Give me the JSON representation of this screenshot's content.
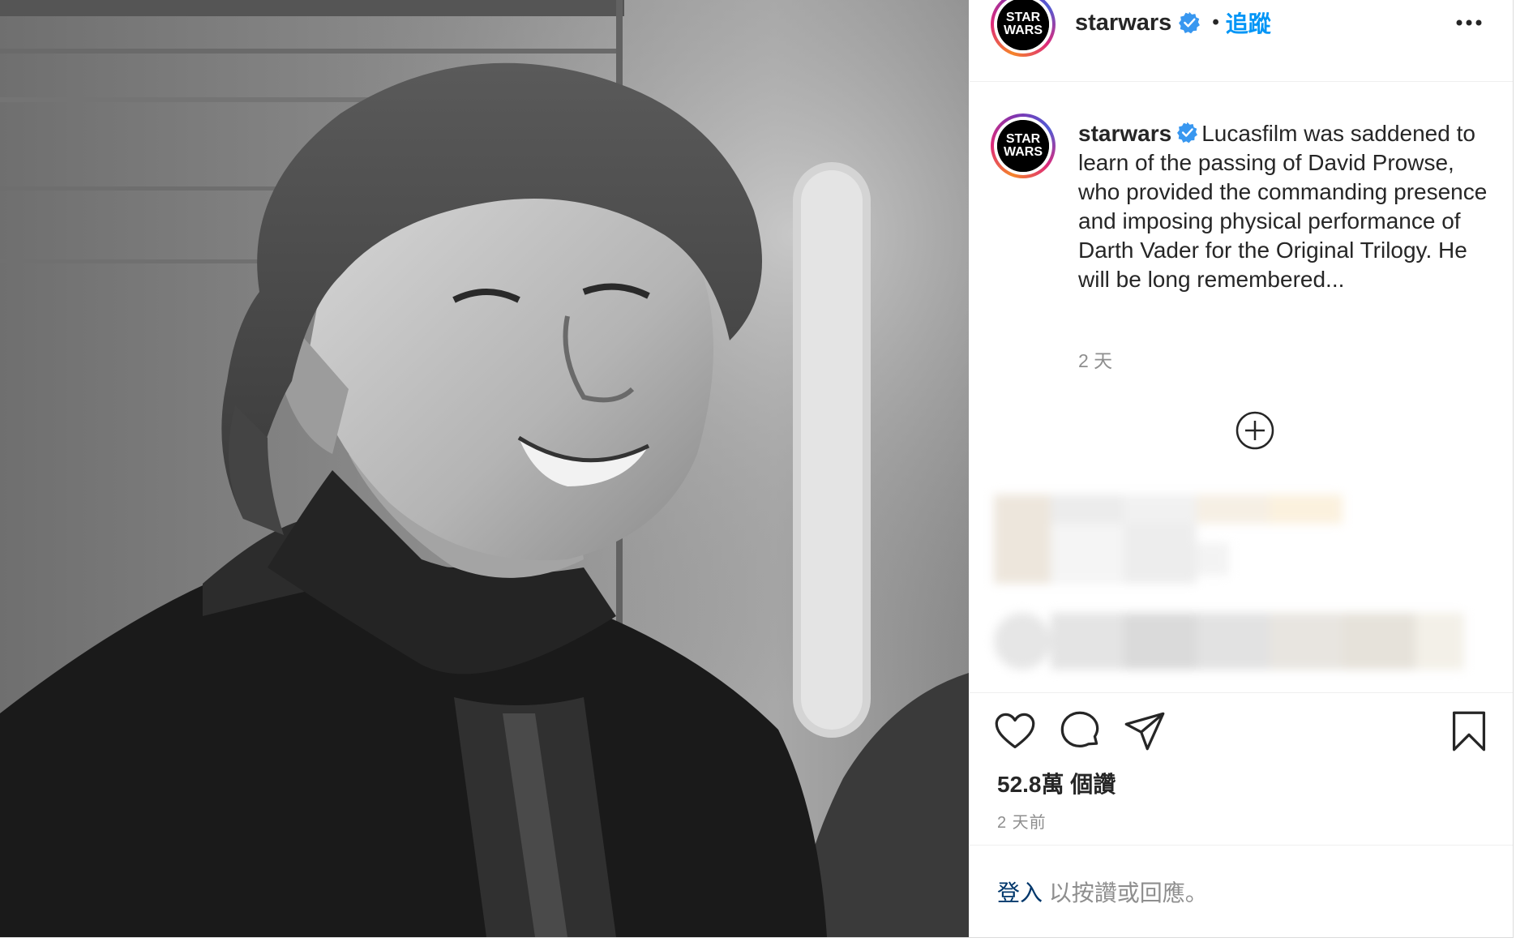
{
  "header": {
    "username": "starwars",
    "separator": "•",
    "follow_label": "追蹤",
    "avatar_logo": {
      "line1": "STAR",
      "line2": "WARS"
    }
  },
  "caption": {
    "username": "starwars",
    "text": "Lucasfilm was saddened to learn of the passing of David Prowse, who provided the commanding presence and imposing physical performance of Darth Vader for the Original Trilogy. He will be long remembered...",
    "age": "2 天"
  },
  "stats": {
    "views": "52.8萬 個讚",
    "date": "2 天前"
  },
  "footer": {
    "login_label": "登入",
    "login_suffix": " 以按讚或回應。"
  },
  "icons": {
    "verified": "verified-badge-icon",
    "more": "more-options-icon",
    "load_more": "plus-circle-icon",
    "like": "heart-icon",
    "comment": "comment-icon",
    "share": "paper-plane-icon",
    "save": "bookmark-icon"
  },
  "colors": {
    "verified_blue": "#3897f0",
    "link_blue": "#0095f6",
    "text_dark": "#262626",
    "text_muted": "#8e8e8e"
  }
}
